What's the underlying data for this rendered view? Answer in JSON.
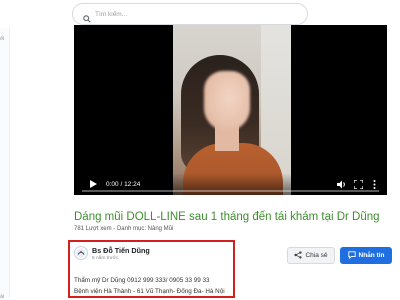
{
  "search": {
    "placeholder": "Tìm kiếm..."
  },
  "left_strip": {
    "labels": [
      "ối",
      "ài"
    ]
  },
  "video": {
    "time_display": "0:00 / 12:24",
    "progress": 0.0
  },
  "post": {
    "title": "Dáng mũi DOLL-LINE sau 1 tháng đến tái khám tại Dr Dũng",
    "meta": "781 Lượt xem - Danh mục: Nâng Mũi"
  },
  "author": {
    "name": "Bs Đỗ Tiến Dũng",
    "time_ago": "5 năm trước",
    "desc_line1": "Thẩm mỹ Dr Dũng 0912 999 333/ 0905 33 99 33",
    "desc_line2": "Bệnh viện Hà Thành - 61 Vũ Thạnh- Đống Đa- Hà Nội"
  },
  "actions": {
    "share_label": "Chia sẻ",
    "message_label": "Nhắn tin"
  },
  "colors": {
    "title": "#3f8e2f",
    "highlight_border": "#d41f1f",
    "message_button": "#1f6fe0"
  }
}
